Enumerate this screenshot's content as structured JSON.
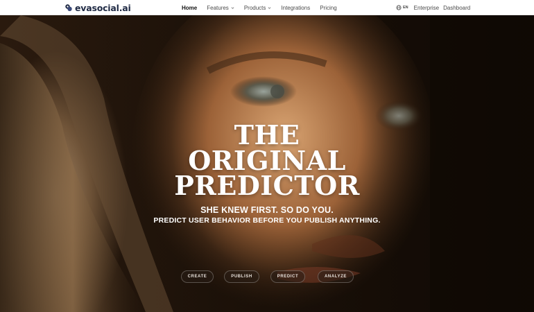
{
  "brand": {
    "name": "evasocial.ai"
  },
  "nav": {
    "home": "Home",
    "features": "Features",
    "products": "Products",
    "integrations": "Integrations",
    "pricing": "Pricing"
  },
  "right_nav": {
    "language": "EN",
    "enterprise": "Enterprise",
    "dashboard": "Dashboard"
  },
  "hero": {
    "headline_line1": "THE",
    "headline_line2": "ORIGINAL",
    "headline_line3": "PREDICTOR",
    "subtitle_line1": "SHE KNEW FIRST. SO DO YOU.",
    "subtitle_line2": "PREDICT USER BEHAVIOR BEFORE YOU PUBLISH ANYTHING.",
    "steps": [
      "CREATE",
      "PUBLISH",
      "PREDICT",
      "ANALYZE"
    ]
  },
  "icons": {
    "logo": "eva-logo-icon",
    "globe": "globe-icon",
    "dropdown": "chevron-down-icon"
  },
  "colors": {
    "brand_text": "#1f2a44",
    "nav_bg": "#ffffff",
    "hero_text": "#ffffff",
    "hero_bg": "#1a110a"
  }
}
